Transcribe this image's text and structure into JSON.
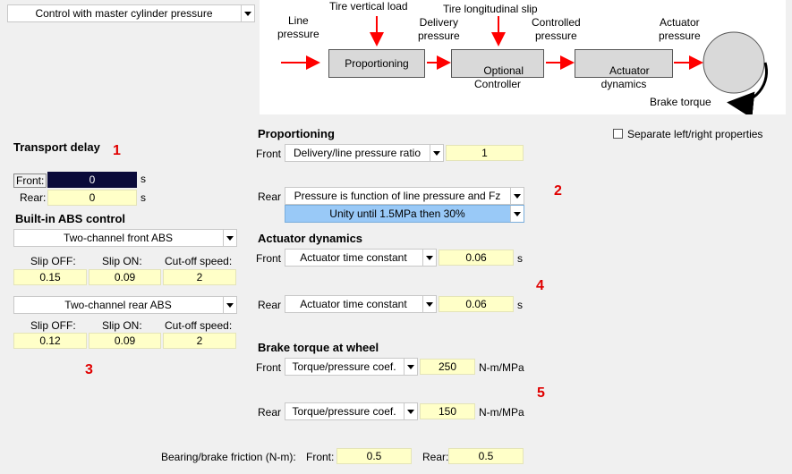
{
  "mode_select": "Control with master cylinder pressure",
  "diagram": {
    "line_pressure": "Line\npressure",
    "tire_vertical_load": "Tire vertical load",
    "delivery_pressure": "Delivery\npressure",
    "tire_longitudinal_slip": "Tire longitudinal slip",
    "controlled_pressure": "Controlled\npressure",
    "actuator_pressure": "Actuator\npressure",
    "brake_torque": "Brake torque",
    "block_proportioning": "Proportioning",
    "block_controller": "Optional\nController",
    "block_actuator": "Actuator\ndynamics"
  },
  "transport_delay": {
    "title": "Transport delay",
    "front_label": "Front:",
    "front_value": "0",
    "rear_label": "Rear:",
    "rear_value": "0",
    "unit": "s"
  },
  "abs": {
    "title": "Built-in ABS control",
    "front_select": "Two-channel front ABS",
    "rear_select": "Two-channel rear ABS",
    "col_slip_off": "Slip OFF:",
    "col_slip_on": "Slip ON:",
    "col_cutoff": "Cut-off speed:",
    "front_values": [
      "0.15",
      "0.09",
      "2"
    ],
    "rear_values": [
      "0.12",
      "0.09",
      "2"
    ]
  },
  "proportioning": {
    "title": "Proportioning",
    "front_label": "Front",
    "front_select": "Delivery/line pressure ratio",
    "front_value": "1",
    "rear_label": "Rear",
    "rear_select": "Pressure is function of line pressure and Fz",
    "rear_sub_select": "Unity until 1.5MPa then 30%"
  },
  "separate_checkbox_label": "Separate left/right properties",
  "actuator": {
    "title": "Actuator dynamics",
    "front_label": "Front",
    "front_select": "Actuator time constant",
    "front_value": "0.06",
    "rear_label": "Rear",
    "rear_select": "Actuator time constant",
    "rear_value": "0.06",
    "unit": "s"
  },
  "brake_torque": {
    "title": "Brake torque at wheel",
    "front_label": "Front",
    "front_select": "Torque/pressure coef.",
    "front_value": "250",
    "rear_label": "Rear",
    "rear_select": "Torque/pressure coef.",
    "rear_value": "150",
    "unit": "N-m/MPa"
  },
  "bearing": {
    "label": "Bearing/brake friction (N-m):",
    "front_label": "Front:",
    "front_value": "0.5",
    "rear_label": "Rear:",
    "rear_value": "0.5"
  },
  "markers": [
    "1",
    "2",
    "3",
    "4",
    "5"
  ],
  "colors": {
    "field_bg": "#ffffc8",
    "highlight": "#99c9f7",
    "marker": "#e00000",
    "arrow": "#ff0000",
    "selected_field": "#0a0a3a"
  }
}
